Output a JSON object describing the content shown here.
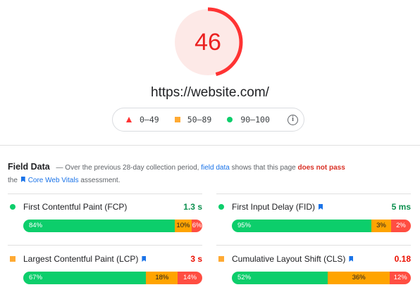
{
  "score": {
    "value": "46",
    "fraction": 0.46,
    "color": "#ff3333",
    "bg": "#fde9e7"
  },
  "url": "https://website.com/",
  "legend": {
    "fail": "0–49",
    "average": "50–89",
    "pass": "90–100",
    "info_icon": "info-icon"
  },
  "field_data": {
    "title": "Field Data",
    "text1": "— Over the previous 28-day collection period,",
    "link": "field data",
    "text2": "shows that this page",
    "verdict": "does not pass",
    "text3": "the",
    "cwv": "Core Web Vitals",
    "text4": "assessment."
  },
  "metrics": {
    "fcp": {
      "name": "First Contentful Paint (FCP)",
      "value": "1.3 s",
      "status": "good",
      "fast": "84%",
      "average": "10%",
      "slow": "6%"
    },
    "fid": {
      "name": "First Input Delay (FID)",
      "value": "5 ms",
      "status": "good",
      "fast": "95%",
      "average": "3%",
      "slow": "2%"
    },
    "lcp": {
      "name": "Largest Contentful Paint (LCP)",
      "value": "3 s",
      "status": "average",
      "fast": "67%",
      "average": "18%",
      "slow": "14%"
    },
    "cls": {
      "name": "Cumulative Layout Shift (CLS)",
      "value": "0.18",
      "status": "average",
      "fast": "52%",
      "average": "36%",
      "slow": "12%"
    }
  },
  "colors": {
    "fast": "#0cce6b",
    "average": "#ffa400",
    "slow": "#ff4e42",
    "link": "#1a73e8"
  }
}
